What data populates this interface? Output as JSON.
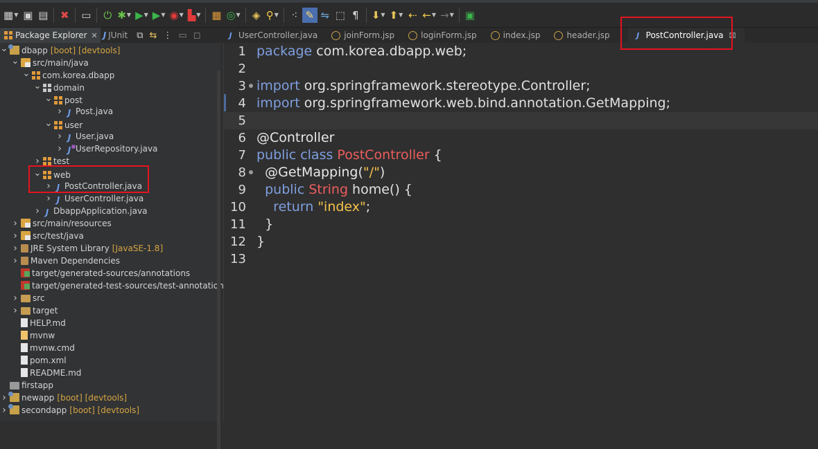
{
  "explorer": {
    "tabs": [
      {
        "label": "Package Explorer",
        "active": true
      },
      {
        "label": "JUnit",
        "active": false
      }
    ],
    "tree": [
      {
        "id": "dbapp",
        "depth": 0,
        "twisty": "open",
        "icon": "project",
        "label": "dbapp",
        "deco": "[boot] [devtools]"
      },
      {
        "id": "src-main-java",
        "depth": 1,
        "twisty": "open",
        "icon": "src",
        "label": "src/main/java"
      },
      {
        "id": "com-korea-dbapp",
        "depth": 2,
        "twisty": "open",
        "icon": "pkg-full",
        "label": "com.korea.dbapp"
      },
      {
        "id": "domain",
        "depth": 3,
        "twisty": "open",
        "icon": "pkg",
        "label": "domain"
      },
      {
        "id": "post",
        "depth": 4,
        "twisty": "open",
        "icon": "pkg-full",
        "label": "post"
      },
      {
        "id": "post-java",
        "depth": 5,
        "twisty": "closed",
        "icon": "java",
        "label": "Post.java"
      },
      {
        "id": "user",
        "depth": 4,
        "twisty": "open",
        "icon": "pkg-full",
        "label": "user"
      },
      {
        "id": "user-java",
        "depth": 5,
        "twisty": "closed",
        "icon": "java",
        "label": "User.java"
      },
      {
        "id": "userrepository-java",
        "depth": 5,
        "twisty": "closed",
        "icon": "iface",
        "label": "UserRepository.java"
      },
      {
        "id": "test",
        "depth": 3,
        "twisty": "closed",
        "icon": "pkg-full",
        "label": "test"
      },
      {
        "id": "web",
        "depth": 3,
        "twisty": "open",
        "icon": "pkg-full",
        "label": "web"
      },
      {
        "id": "postcontroller-java",
        "depth": 4,
        "twisty": "closed",
        "icon": "java",
        "label": "PostController.java"
      },
      {
        "id": "usercontroller-java",
        "depth": 4,
        "twisty": "closed",
        "icon": "java",
        "label": "UserController.java"
      },
      {
        "id": "dbappapplication-java",
        "depth": 3,
        "twisty": "closed",
        "icon": "java",
        "label": "DbappApplication.java"
      },
      {
        "id": "src-main-resources",
        "depth": 1,
        "twisty": "closed",
        "icon": "src",
        "label": "src/main/resources"
      },
      {
        "id": "src-test-java",
        "depth": 1,
        "twisty": "closed",
        "icon": "src",
        "label": "src/test/java"
      },
      {
        "id": "jre",
        "depth": 1,
        "twisty": "closed",
        "icon": "lib",
        "label": "JRE System Library",
        "deco": "[JavaSE-1.8]"
      },
      {
        "id": "maven-deps",
        "depth": 1,
        "twisty": "closed",
        "icon": "lib",
        "label": "Maven Dependencies"
      },
      {
        "id": "gen-sources",
        "depth": 1,
        "twisty": "none",
        "icon": "gen",
        "label": "target/generated-sources/annotations"
      },
      {
        "id": "gen-test-sources",
        "depth": 1,
        "twisty": "none",
        "icon": "gen",
        "label": "target/generated-test-sources/test-annotations"
      },
      {
        "id": "src",
        "depth": 1,
        "twisty": "closed",
        "icon": "folder",
        "label": "src"
      },
      {
        "id": "target",
        "depth": 1,
        "twisty": "closed",
        "icon": "folder",
        "label": "target"
      },
      {
        "id": "help-md",
        "depth": 1,
        "twisty": "none",
        "icon": "file",
        "label": "HELP.md"
      },
      {
        "id": "mvnw",
        "depth": 1,
        "twisty": "none",
        "icon": "mvn",
        "label": "mvnw"
      },
      {
        "id": "mvnw-cmd",
        "depth": 1,
        "twisty": "none",
        "icon": "file",
        "label": "mvnw.cmd"
      },
      {
        "id": "pom-xml",
        "depth": 1,
        "twisty": "none",
        "icon": "xml",
        "label": "pom.xml"
      },
      {
        "id": "readme-md",
        "depth": 1,
        "twisty": "none",
        "icon": "file",
        "label": "README.md"
      },
      {
        "id": "firstapp",
        "depth": 0,
        "twisty": "none",
        "icon": "folder-gray",
        "label": "firstapp"
      },
      {
        "id": "newapp",
        "depth": 0,
        "twisty": "closed",
        "icon": "project",
        "label": "newapp",
        "deco": "[boot] [devtools]"
      },
      {
        "id": "secondapp",
        "depth": 0,
        "twisty": "closed",
        "icon": "project",
        "label": "secondapp",
        "deco": "[boot] [devtools]"
      }
    ]
  },
  "editor": {
    "tabs": [
      {
        "label": "UserController.java",
        "icon": "java",
        "active": false
      },
      {
        "label": "joinForm.jsp",
        "icon": "jsp",
        "active": false
      },
      {
        "label": "loginForm.jsp",
        "icon": "jsp",
        "active": false
      },
      {
        "label": "index.jsp",
        "icon": "jsp",
        "active": false
      },
      {
        "label": "header.jsp",
        "icon": "jsp",
        "active": false
      },
      {
        "label": "PostController.java",
        "icon": "java",
        "active": true
      }
    ],
    "current_line": 5,
    "lines": [
      {
        "n": "1",
        "fold": false,
        "tokens": [
          [
            "kw",
            "package"
          ],
          [
            "plain",
            " com.korea.dbapp.web;"
          ]
        ]
      },
      {
        "n": "2",
        "fold": false,
        "tokens": []
      },
      {
        "n": "3",
        "fold": true,
        "tokens": [
          [
            "kw",
            "import"
          ],
          [
            "plain",
            " org.springframework.stereotype.Controller;"
          ]
        ]
      },
      {
        "n": "4",
        "fold": false,
        "tokens": [
          [
            "kw",
            "import"
          ],
          [
            "plain",
            " org.springframework.web.bind.annotation.GetMapping;"
          ]
        ]
      },
      {
        "n": "5",
        "fold": false,
        "tokens": []
      },
      {
        "n": "6",
        "fold": false,
        "tokens": [
          [
            "ann",
            "@Controller"
          ]
        ]
      },
      {
        "n": "7",
        "fold": false,
        "tokens": [
          [
            "kw",
            "public class "
          ],
          [
            "cls",
            "PostController"
          ],
          [
            "plain",
            " {"
          ]
        ]
      },
      {
        "n": "8",
        "fold": true,
        "tokens": [
          [
            "plain",
            "  "
          ],
          [
            "ann",
            "@GetMapping"
          ],
          [
            "plain",
            "("
          ],
          [
            "str",
            "\"/\""
          ],
          [
            "plain",
            ")"
          ]
        ]
      },
      {
        "n": "9",
        "fold": false,
        "tokens": [
          [
            "plain",
            "  "
          ],
          [
            "kw",
            "public "
          ],
          [
            "cls",
            "String"
          ],
          [
            "plain",
            " home() {"
          ]
        ]
      },
      {
        "n": "10",
        "fold": false,
        "tokens": [
          [
            "plain",
            "    "
          ],
          [
            "kw",
            "return "
          ],
          [
            "str",
            "\"index\""
          ],
          [
            "plain",
            ";"
          ]
        ]
      },
      {
        "n": "11",
        "fold": false,
        "tokens": [
          [
            "plain",
            "  }"
          ]
        ]
      },
      {
        "n": "12",
        "fold": false,
        "tokens": [
          [
            "plain",
            "}"
          ]
        ]
      },
      {
        "n": "13",
        "fold": false,
        "tokens": []
      }
    ]
  },
  "colors": {
    "highlight": "#e5141e",
    "keyword": "#7f9fe0",
    "class": "#ee5d5d",
    "string": "#f5c24b"
  }
}
